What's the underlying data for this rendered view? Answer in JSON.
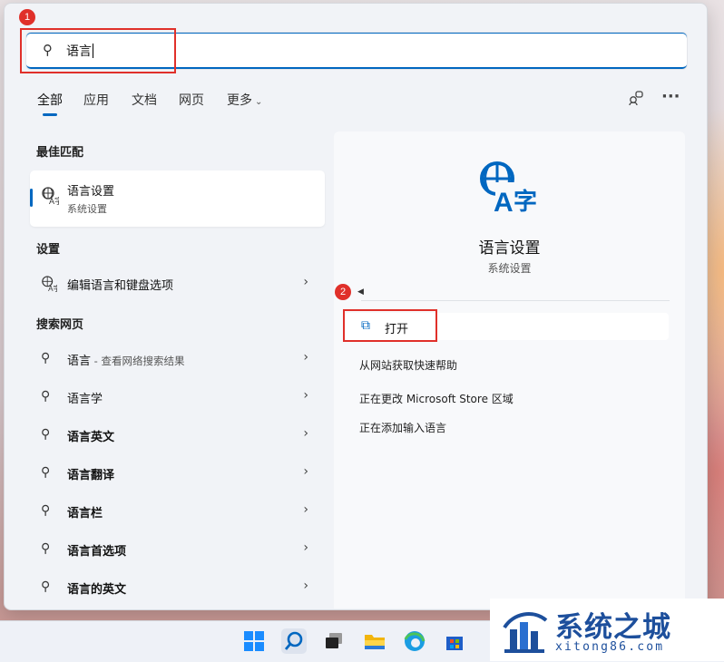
{
  "search": {
    "value": "语言"
  },
  "annotations": {
    "badge1": "1",
    "badge2": "2"
  },
  "tabs": [
    {
      "label": "全部",
      "active": true
    },
    {
      "label": "应用"
    },
    {
      "label": "文档"
    },
    {
      "label": "网页"
    },
    {
      "label": "更多"
    }
  ],
  "header_icons": [
    "account-switch-icon",
    "more-options-icon"
  ],
  "left": {
    "best_match_heading": "最佳匹配",
    "best_match": {
      "title": "语言设置",
      "subtitle": "系统设置",
      "icon": "language-icon"
    },
    "settings_heading": "设置",
    "settings_items": [
      {
        "label": "编辑语言和键盘选项",
        "icon": "language-icon"
      }
    ],
    "web_heading": "搜索网页",
    "web_items": [
      {
        "label": "语言",
        "suffix": " - 查看网络搜索结果"
      },
      {
        "label": "语言学"
      },
      {
        "label": "语言英文"
      },
      {
        "label": "语言翻译"
      },
      {
        "label": "语言栏"
      },
      {
        "label": "语言首选项"
      },
      {
        "label": "语言的英文"
      }
    ]
  },
  "right": {
    "title": "语言设置",
    "subtitle": "系统设置",
    "open_label": "打开",
    "links": [
      "从网站获取快速帮助",
      "正在更改 Microsoft Store 区域",
      "正在添加输入语言"
    ]
  },
  "taskbar": [
    "start-icon",
    "search-icon",
    "task-view-icon",
    "file-explorer-icon",
    "edge-icon",
    "store-icon"
  ],
  "watermark": {
    "brand": "系统之城",
    "url": "xitong86.com"
  },
  "colors": {
    "accent": "#0067c0",
    "annotation_red": "#e0302a",
    "brand_blue": "#1d4f9c"
  }
}
